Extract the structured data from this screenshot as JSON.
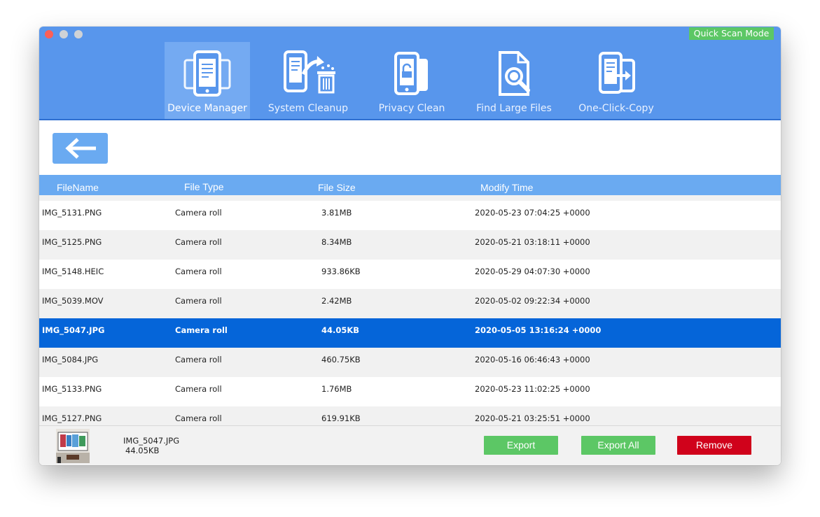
{
  "header": {
    "quick_scan_label": "Quick Scan Mode",
    "tabs": [
      {
        "label": "Device Manager",
        "icon": "phone-document-icon",
        "active": true
      },
      {
        "label": "System Cleanup",
        "icon": "phone-trash-icon",
        "active": false
      },
      {
        "label": "Privacy Clean",
        "icon": "phone-lock-icon",
        "active": false
      },
      {
        "label": "Find Large Files",
        "icon": "file-search-icon",
        "active": false
      },
      {
        "label": "One-Click-Copy",
        "icon": "phone-copy-icon",
        "active": false
      }
    ]
  },
  "table": {
    "columns": [
      "FileName",
      "File Type",
      "File Size",
      "Modify Time"
    ],
    "rows": [
      {
        "name": "IMG_5131.PNG",
        "type": "Camera roll",
        "size": "3.81MB",
        "time": "2020-05-23 07:04:25 +0000"
      },
      {
        "name": "IMG_5125.PNG",
        "type": "Camera roll",
        "size": "8.34MB",
        "time": "2020-05-21 03:18:11 +0000"
      },
      {
        "name": "IMG_5148.HEIC",
        "type": "Camera roll",
        "size": "933.86KB",
        "time": "2020-05-29 04:07:30 +0000"
      },
      {
        "name": "IMG_5039.MOV",
        "type": "Camera roll",
        "size": "2.42MB",
        "time": "2020-05-02 09:22:34 +0000"
      },
      {
        "name": "IMG_5047.JPG",
        "type": "Camera roll",
        "size": "44.05KB",
        "time": "2020-05-05 13:16:24 +0000",
        "selected": true
      },
      {
        "name": "IMG_5084.JPG",
        "type": "Camera roll",
        "size": "460.75KB",
        "time": "2020-05-16 06:46:43 +0000"
      },
      {
        "name": "IMG_5133.PNG",
        "type": "Camera roll",
        "size": "1.76MB",
        "time": "2020-05-23 11:02:25 +0000"
      },
      {
        "name": "IMG_5127.PNG",
        "type": "Camera roll",
        "size": "619.91KB",
        "time": "2020-05-21 03:25:51 +0000"
      }
    ]
  },
  "footer": {
    "selected_name": "IMG_5047.JPG",
    "selected_size": "44.05KB",
    "export_label": "Export",
    "export_all_label": "Export All",
    "remove_label": "Remove"
  },
  "colors": {
    "header": "#5896ec",
    "active_tab": "#74aaf2",
    "table_header": "#6aaaf1",
    "selected_row": "#0565d9",
    "green": "#5cc765",
    "red": "#d0021b"
  }
}
